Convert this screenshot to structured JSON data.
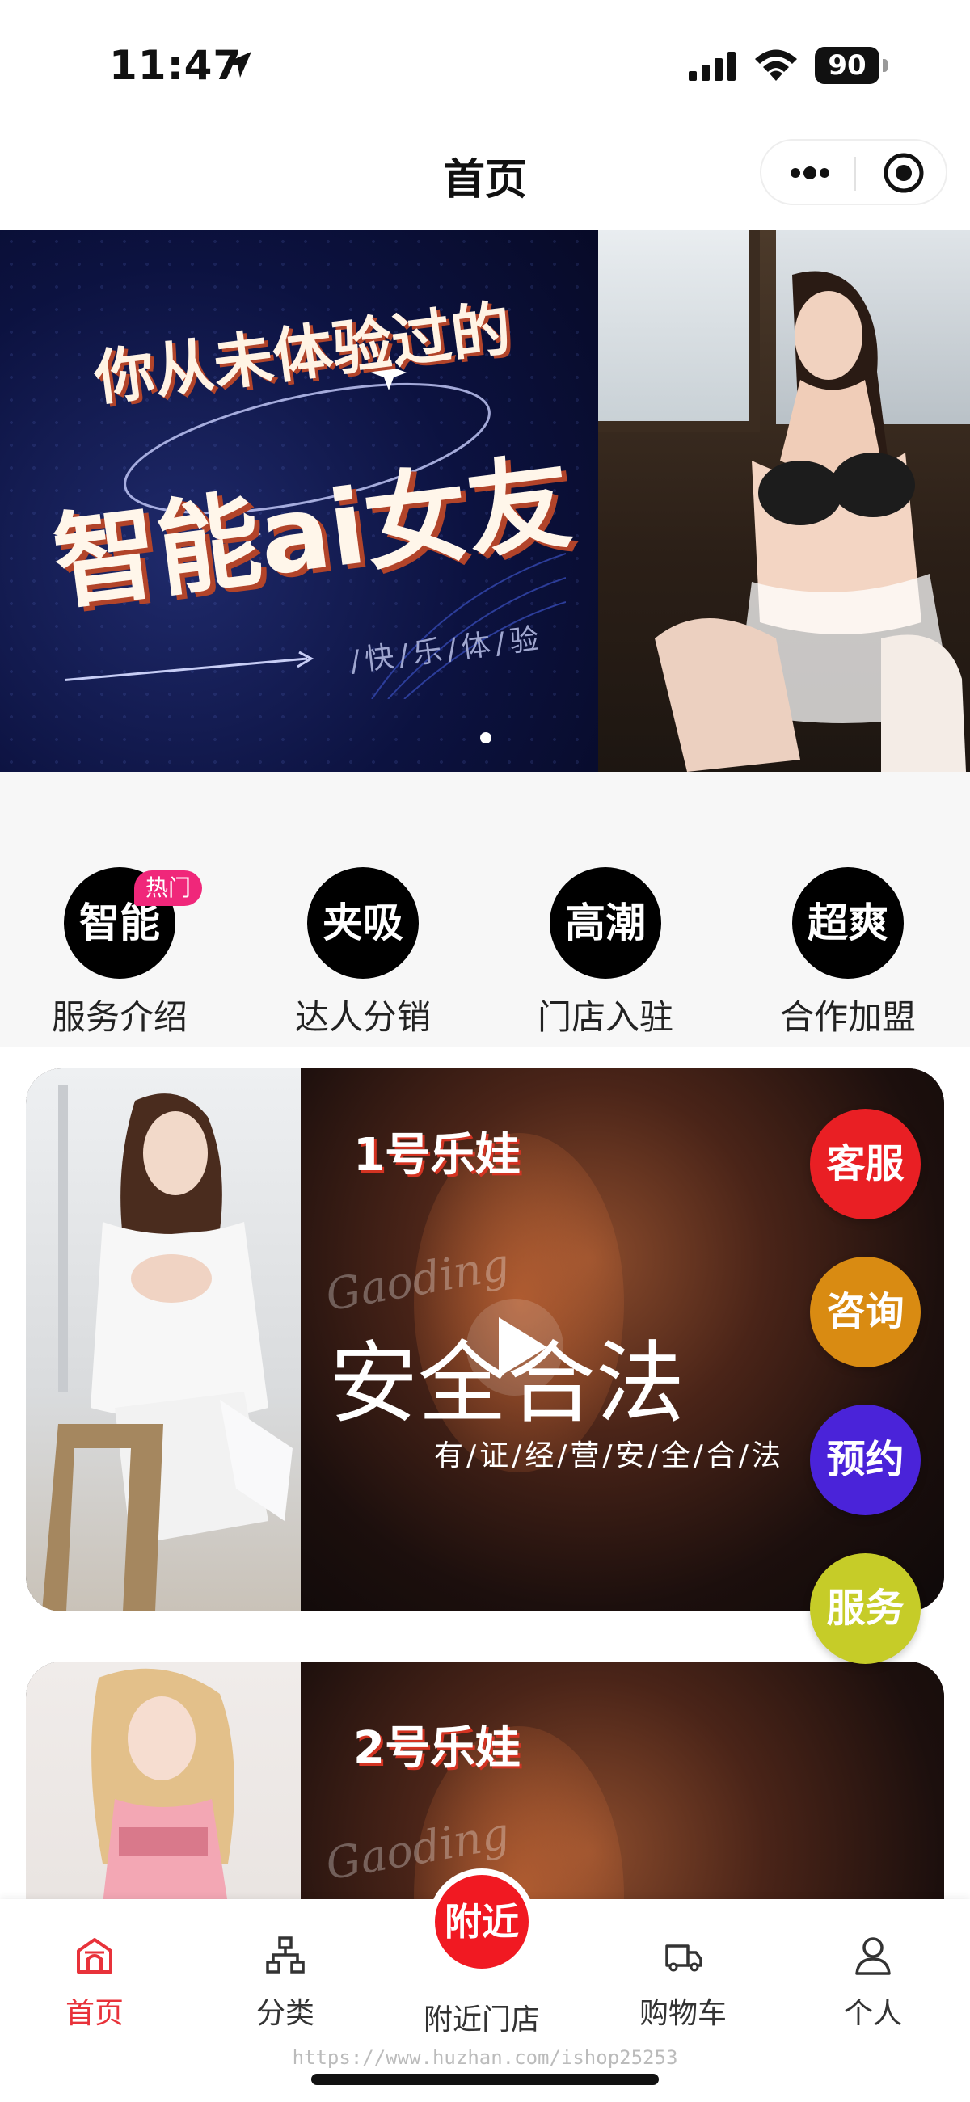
{
  "status_bar": {
    "time": "11:47",
    "battery": "90"
  },
  "nav": {
    "title": "首页"
  },
  "banner": {
    "title_line1": "你从未体验过的",
    "title_line2": "智能ai女友",
    "subtitle": "/快/乐/体/验"
  },
  "quick_menu": {
    "hot_badge": "热门",
    "items": [
      {
        "circle": "智能",
        "label": "服务介绍"
      },
      {
        "circle": "夹吸",
        "label": "达人分销"
      },
      {
        "circle": "高潮",
        "label": "门店入驻"
      },
      {
        "circle": "超爽",
        "label": "合作加盟"
      }
    ]
  },
  "cards": [
    {
      "title": "1号乐娃",
      "watermark": "Gaoding",
      "headline": "安全合法",
      "slogan": "有/证/经/营/安/全/合/法"
    },
    {
      "title": "2号乐娃",
      "watermark": "Gaoding"
    }
  ],
  "float_buttons": [
    {
      "label": "客服",
      "color": "#e91f24"
    },
    {
      "label": "咨询",
      "color": "#d98b12"
    },
    {
      "label": "预约",
      "color": "#4a23d9"
    },
    {
      "label": "服务",
      "color": "#c6cc28"
    }
  ],
  "tab_bar": {
    "home": "首页",
    "category": "分类",
    "nearby_circle": "附近",
    "nearby": "附近门店",
    "cart": "购物车",
    "profile": "个人"
  },
  "footer_url": "https://www.huzhan.com/ishop25253",
  "colors": {
    "accent": "#e8323a",
    "hot": "#f0277a"
  }
}
